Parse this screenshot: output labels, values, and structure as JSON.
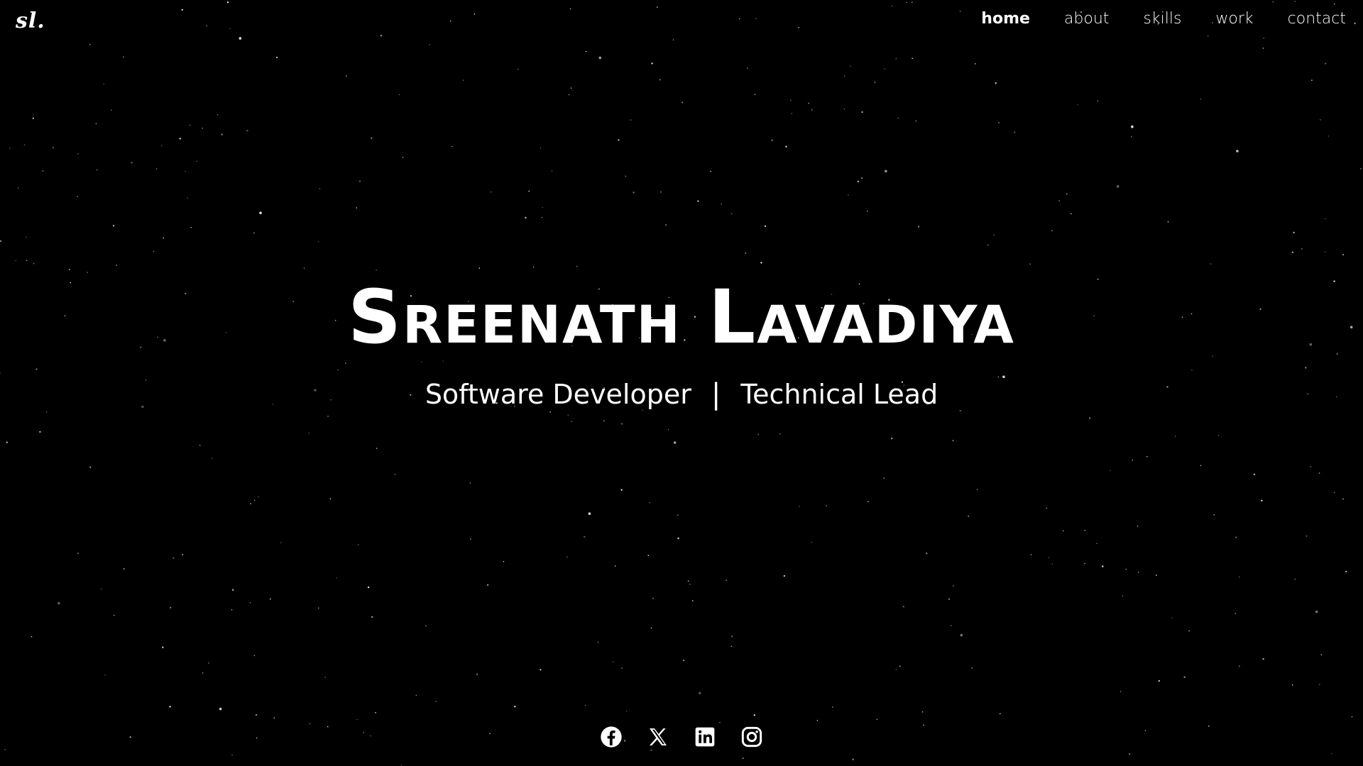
{
  "header": {
    "logo": "sl.",
    "nav": [
      {
        "label": "home",
        "active": true
      },
      {
        "label": "about",
        "active": false
      },
      {
        "label": "skills",
        "active": false
      },
      {
        "label": "work",
        "active": false
      },
      {
        "label": "contact",
        "active": false
      }
    ]
  },
  "hero": {
    "name": "Sreenath Lavadiya",
    "role1": "Software Developer",
    "separator": "|",
    "role2": "Technical Lead"
  },
  "social": {
    "icons": [
      "facebook-icon",
      "x-icon",
      "linkedin-icon",
      "instagram-icon"
    ]
  },
  "colors": {
    "background": "#000000",
    "text": "#ffffff",
    "star": "#ffffff"
  }
}
